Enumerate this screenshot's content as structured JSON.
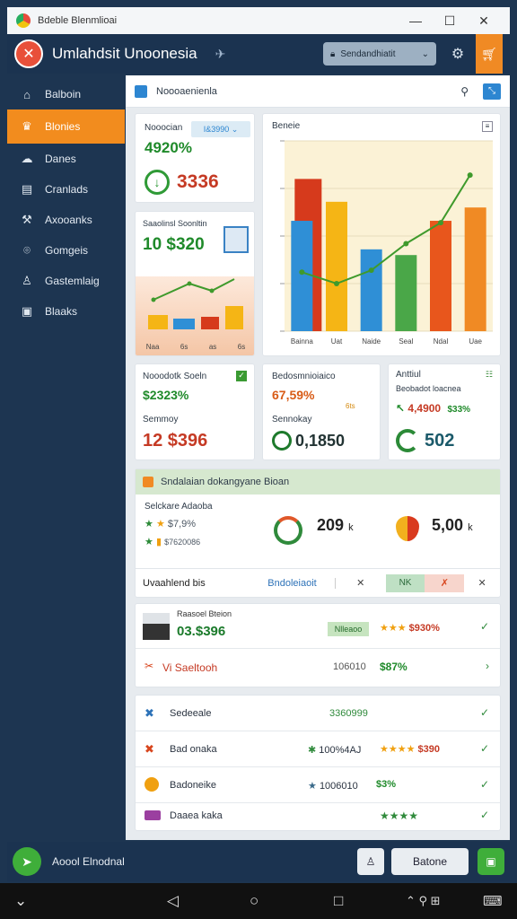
{
  "window": {
    "title": "Bdeble Blenmlioai",
    "controls": [
      "—",
      "☐",
      "✕"
    ]
  },
  "header": {
    "brand": "Umlahdsit Unoonesia",
    "select": "Sendandhiatit"
  },
  "sidebar": {
    "items": [
      {
        "label": "Balboin",
        "icon": "home-icon",
        "glyph": "⌂"
      },
      {
        "label": "Blonies",
        "icon": "trophy-icon",
        "glyph": "♛"
      },
      {
        "label": "Danes",
        "icon": "cloud-icon",
        "glyph": "☁"
      },
      {
        "label": "Cranlads",
        "icon": "chart-icon",
        "glyph": "▤"
      },
      {
        "label": "Axooanks",
        "icon": "tools-icon",
        "glyph": "⚒"
      },
      {
        "label": "Gomgeis",
        "icon": "location-icon",
        "glyph": "⌾"
      },
      {
        "label": "Gastemlaig",
        "icon": "user-icon",
        "glyph": "♙"
      },
      {
        "label": "Blaaks",
        "icon": "image-icon",
        "glyph": "▣"
      }
    ]
  },
  "main": {
    "panel_title": "Noooaenienla",
    "kpi1": {
      "label": "Nooocian",
      "pill": "I&3990",
      "pct": "4920%",
      "value": "3336"
    },
    "kpi2": {
      "label": "Saaolinsl Soonltin",
      "value": "10 $320",
      "mini_chart": {
        "type": "bar",
        "categories": [
          "Naa",
          "6s",
          "as",
          "6s"
        ]
      }
    },
    "stat1": {
      "title": "Nooodotk Soeln",
      "pct": "$2323%",
      "sub": "Semmoy",
      "value": "12 $396"
    },
    "stat2": {
      "title": "Bedosmnioiaico",
      "pct": "67,59%",
      "small": "6ts",
      "sub": "Sennokay",
      "value": "0,1850"
    },
    "stat3": {
      "title": "Anttiul",
      "sub": "Beobadot loacnea",
      "value1": "4,4900",
      "pct": "$33%",
      "value2": "502"
    },
    "section": {
      "title": "Sndalaian dokangyane Bioan",
      "sub": "Selckare Adaoba",
      "row1": "$7,9%",
      "row2": "$7620086",
      "m1": "209",
      "m1unit": "k",
      "m2": "5,00",
      "m2unit": "k"
    },
    "tabs": {
      "title": "Uvaahlend bis",
      "active": "Bndoleiaoit",
      "t1": "NK"
    },
    "list": [
      {
        "title": "Raasoel Bteion",
        "value": "03.$396",
        "badge": "Nlleaoo",
        "rating": "$930%"
      },
      {
        "title": "Vi Saeltooh",
        "value": "106010",
        "pct": "$87%"
      }
    ],
    "list2": [
      {
        "title": "Sedeeale",
        "value": "3360999"
      },
      {
        "title": "Bad onaka",
        "value": "100%4AJ",
        "pct": "$390"
      },
      {
        "title": "Badoneike",
        "value": "1006010",
        "pct": "$3%"
      },
      {
        "title": "Daaea kaka",
        "value": ""
      }
    ]
  },
  "chart_data": {
    "type": "bar",
    "title": "Beneie",
    "categories": [
      "Bainna",
      "Uat",
      "Naide",
      "Seal",
      "Ndal",
      "Uae"
    ],
    "series": [
      {
        "values": [
          58,
          68,
          43,
          40,
          58,
          65
        ]
      }
    ],
    "line_values": [
      31,
      25,
      32,
      46,
      57,
      82
    ],
    "ylim": [
      0,
      100
    ],
    "colors": [
      "#2f8fd6",
      "#f5b515",
      "#2f8fd6",
      "#4aa748",
      "#e8561c",
      "#f08a24"
    ],
    "accent_colors": [
      "#d63a1c"
    ],
    "line_color": "#3f9a2c"
  },
  "footer": {
    "text": "Aoool Elnodnal",
    "button": "Batone"
  },
  "colors": {
    "accent": "#f28c1e",
    "sidebar": "#1d3551",
    "green": "#3fae3a"
  }
}
